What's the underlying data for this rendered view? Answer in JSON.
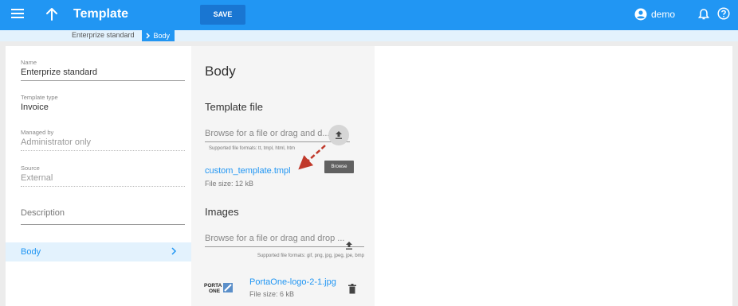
{
  "header": {
    "title": "Template",
    "save_label": "SAVE",
    "user_name": "demo"
  },
  "breadcrumb": {
    "items": [
      "Enterprize standard",
      "Body"
    ]
  },
  "left_panel": {
    "name": {
      "label": "Name",
      "value": "Enterprize standard"
    },
    "template_type": {
      "label": "Template type",
      "value": "Invoice"
    },
    "managed_by": {
      "label": "Managed by",
      "value": "Administrator only"
    },
    "source": {
      "label": "Source",
      "value": "External"
    },
    "description_placeholder": "Description",
    "nav": [
      {
        "label": "Body",
        "selected": true
      }
    ]
  },
  "body_panel": {
    "title": "Body",
    "template_file": {
      "heading": "Template file",
      "browse_placeholder": "Browse for a file or drag and d...",
      "formats": "Supported file formats: tt, tmpl, html, htm",
      "file_name": "custom_template.tmpl",
      "file_size": "File size: 12 kB",
      "tooltip": "Browse"
    },
    "images": {
      "heading": "Images",
      "browse_placeholder": "Browse for a file or drag and drop ...",
      "formats": "Supported file formats: gif, png, jpg, jpeg, jpe, bmp",
      "file_name": "PortaOne-logo-2-1.jpg",
      "file_size": "File size: 6 kB",
      "thumbnail_text": [
        "PORTA",
        "ONE"
      ]
    }
  },
  "colors": {
    "primary": "#2196f3",
    "accent_dark": "#1976d2",
    "selected_bg": "#e3f2fd",
    "annotation_arrow": "#c0392b"
  },
  "icons": {
    "menu": "menu-icon",
    "up": "arrow-up-icon",
    "user": "account-circle-icon",
    "bell": "bell-icon",
    "help": "help-circle-icon",
    "upload": "upload-icon",
    "delete": "trash-icon",
    "chevron": "chevron-right-icon"
  }
}
